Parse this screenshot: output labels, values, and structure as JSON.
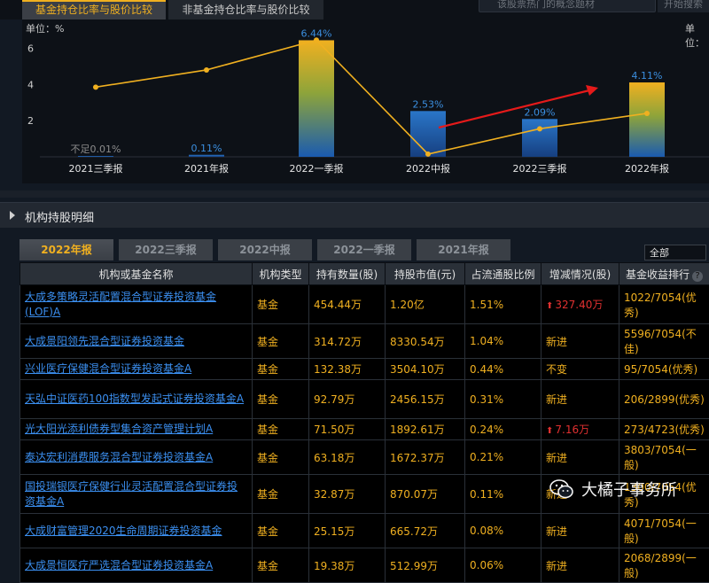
{
  "top_tabs": {
    "active": "基金持仓比率与股价比较",
    "inactive": "非基金持仓比率与股价比较"
  },
  "search": {
    "placeholder": "该股票热门的概念题材",
    "button": "开始搜索"
  },
  "chart_data": {
    "type": "bar",
    "categories": [
      "2021三季报",
      "2021年报",
      "2022一季报",
      "2022中报",
      "2022三季报",
      "2022年报"
    ],
    "series": [
      {
        "values": [
          0.01,
          0.11,
          6.44,
          2.53,
          2.09,
          4.11
        ]
      }
    ],
    "bar_labels": [
      "不足0.01%",
      "0.11%",
      "6.44%",
      "2.53%",
      "2.09%",
      "4.11%"
    ],
    "line_values": [
      3.85,
      4.8,
      6.45,
      0.15,
      1.55,
      2.4
    ],
    "ylabel": "单位：%",
    "y_ticks": [
      "6",
      "4",
      "2"
    ],
    "right_unit": "单位：",
    "ylim": [
      0,
      7
    ],
    "colors": {
      "line": "#f0b020",
      "bar_top": "#f0b020",
      "bar_bottom": "#1a5bb0",
      "arrow": "#e51a1a"
    }
  },
  "section": {
    "title": "机构持股明细"
  },
  "sub_tabs": [
    "2022年报",
    "2022三季报",
    "2022中报",
    "2022一季报",
    "2021年报"
  ],
  "filter": {
    "selected": "全部"
  },
  "table": {
    "headers": [
      "机构或基金名称",
      "机构类型",
      "持有数量(股)",
      "持股市值(元)",
      "占流通股比例",
      "增减情况(股)",
      "基金收益排行"
    ],
    "rows": [
      {
        "name": "大成多策略灵活配置混合型证券投资基金(LOF)A",
        "type": "基金",
        "qty": "454.44万",
        "value": "1.20亿",
        "ratio": "1.51%",
        "change": "327.40万",
        "change_up": true,
        "rank": "1022/7054(优秀)"
      },
      {
        "name": "大成景阳领先混合型证券投资基金",
        "type": "基金",
        "qty": "314.72万",
        "value": "8330.54万",
        "ratio": "1.04%",
        "change": "新进",
        "change_up": false,
        "rank": "5596/7054(不佳)"
      },
      {
        "name": "兴业医疗保健混合型证券投资基金A",
        "type": "基金",
        "qty": "132.38万",
        "value": "3504.10万",
        "ratio": "0.44%",
        "change": "不变",
        "change_up": false,
        "rank": "95/7054(优秀)"
      },
      {
        "name": "天弘中证医药100指数型发起式证券投资基金A",
        "type": "基金",
        "qty": "92.79万",
        "value": "2456.15万",
        "ratio": "0.31%",
        "change": "新进",
        "change_up": false,
        "rank": "206/2899(优秀)"
      },
      {
        "name": "光大阳光添利债券型集合资产管理计划A",
        "type": "基金",
        "qty": "71.50万",
        "value": "1892.61万",
        "ratio": "0.24%",
        "change": "7.16万",
        "change_up": true,
        "rank": "273/4723(优秀)"
      },
      {
        "name": "泰达宏利消费服务混合型证券投资基金A",
        "type": "基金",
        "qty": "63.18万",
        "value": "1672.37万",
        "ratio": "0.21%",
        "change": "新进",
        "change_up": false,
        "rank": "3803/7054(一般)"
      },
      {
        "name": "国投瑞银医疗保健行业灵活配置混合型证券投资基金A",
        "type": "基金",
        "qty": "32.87万",
        "value": "870.07万",
        "ratio": "0.11%",
        "change": "新进",
        "change_up": false,
        "rank": "1300/7054(优秀)"
      },
      {
        "name": "大成财富管理2020生命周期证券投资基金",
        "type": "基金",
        "qty": "25.15万",
        "value": "665.72万",
        "ratio": "0.08%",
        "change": "新进",
        "change_up": false,
        "rank": "4071/7054(一般)"
      },
      {
        "name": "大成景恒医疗严选混合型证券投资基金A",
        "type": "基金",
        "qty": "19.38万",
        "value": "512.99万",
        "ratio": "0.06%",
        "change": "新进",
        "change_up": false,
        "rank": "2068/2899(一般)"
      }
    ]
  },
  "watermark": {
    "text": "大橘子事务所"
  }
}
